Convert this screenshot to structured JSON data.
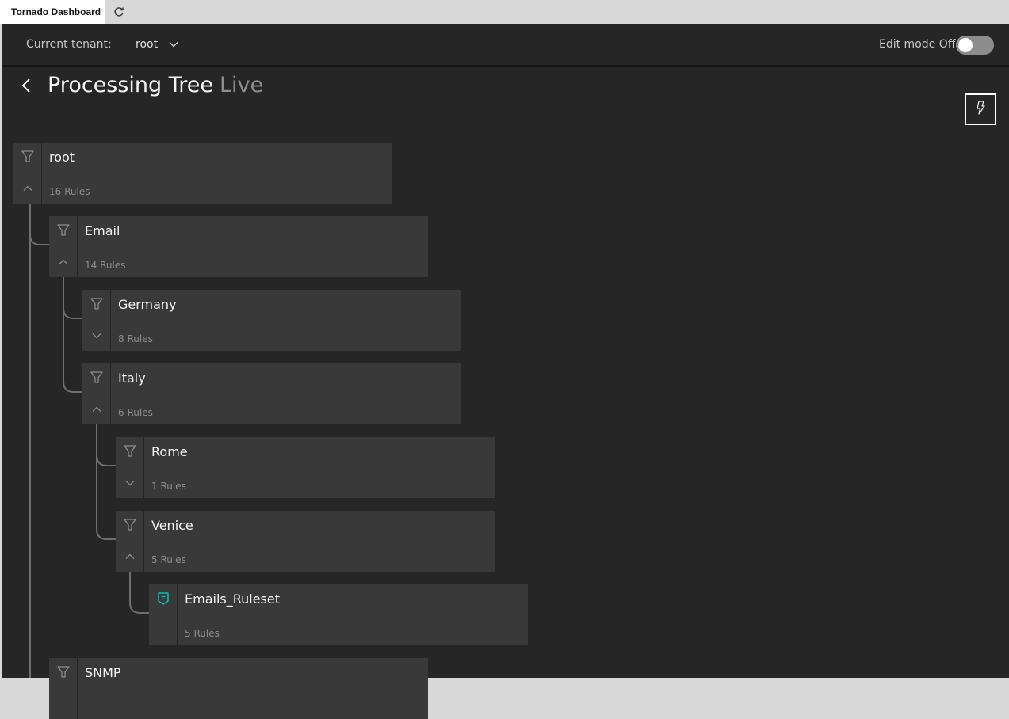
{
  "browser": {
    "tab_title": "Tornado Dashboard",
    "refresh_icon": "refresh-icon"
  },
  "header": {
    "tenant_label": "Current tenant:",
    "tenant_value": "root",
    "edit_mode_label": "Edit mode Off",
    "edit_mode_on": false
  },
  "page": {
    "title": "Processing Tree",
    "status": "Live",
    "back_icon": "chevron-left-icon",
    "action_icon": "lightning-icon"
  },
  "tree": [
    {
      "name": "root",
      "count": "16 Rules",
      "type": "filter",
      "expanded": true,
      "depth": 0
    },
    {
      "name": "Email",
      "count": "14 Rules",
      "type": "filter",
      "expanded": true,
      "depth": 1
    },
    {
      "name": "Germany",
      "count": "8 Rules",
      "type": "filter",
      "expanded": false,
      "depth": 2
    },
    {
      "name": "Italy",
      "count": "6 Rules",
      "type": "filter",
      "expanded": true,
      "depth": 2
    },
    {
      "name": "Rome",
      "count": "1 Rules",
      "type": "filter",
      "expanded": false,
      "depth": 3
    },
    {
      "name": "Venice",
      "count": "5 Rules",
      "type": "filter",
      "expanded": true,
      "depth": 3
    },
    {
      "name": "Emails_Ruleset",
      "count": "5 Rules",
      "type": "ruleset",
      "depth": 4
    },
    {
      "name": "SNMP",
      "count": "",
      "type": "filter",
      "expanded": true,
      "depth": 1
    }
  ],
  "colors": {
    "background": "#262626",
    "card": "#393939",
    "ruleset_accent": "#08bdba"
  }
}
